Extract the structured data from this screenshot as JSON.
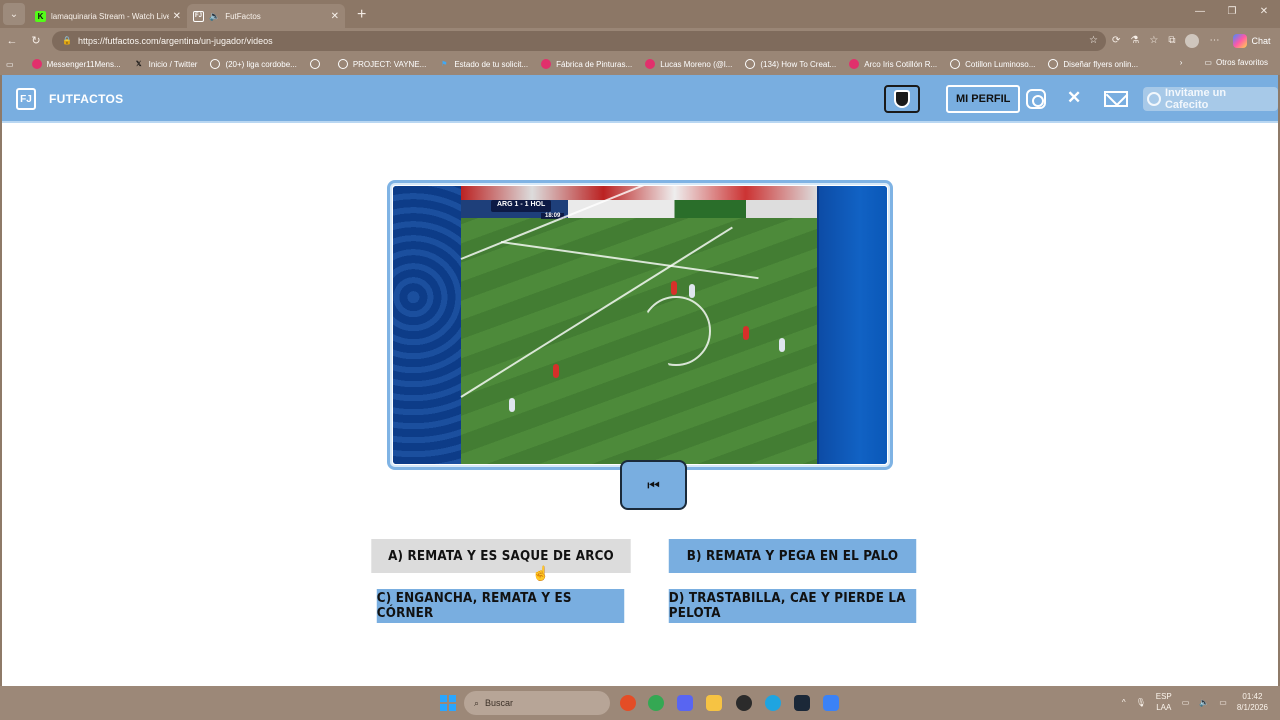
{
  "browser": {
    "tabs": [
      {
        "title": "lamaquinaria Stream - Watch Live",
        "favicon": "K"
      },
      {
        "title": "FutFactos",
        "favicon": "FJ"
      }
    ],
    "url": "https://futfactos.com/argentina/un-jugador/videos",
    "chat_label": "Chat",
    "bookmarks": [
      "Messenger11Mens...",
      "Inicio / Twitter",
      "(20+) liga cordobe...",
      "",
      "PROJECT: VAYNE...",
      "Estado de tu solicit...",
      "Fábrica de Pinturas...",
      "Lucas Moreno (@l...",
      "(134) How To Creat...",
      "Arco Iris Cotillón R...",
      "Cotillon Luminoso...",
      "Diseñar flyers onlin..."
    ],
    "other_favorites": "Otros favoritos"
  },
  "site": {
    "brand": "FUTFACTOS",
    "logo_text": "FJ",
    "profile_label": "MI PERFIL",
    "cafecito_label": "Invitame un Cafecito"
  },
  "video": {
    "score_text": "ARG  1 - 1  HOL",
    "clock_text": "18:09"
  },
  "rewind_icon": "⏮",
  "options": [
    {
      "label": "A) REMATA Y ES SAQUE DE ARCO",
      "selected": true
    },
    {
      "label": "B) REMATA Y PEGA EN EL PALO",
      "selected": false
    },
    {
      "label": "C) ENGANCHA, REMATA Y ES CÓRNER",
      "selected": false
    },
    {
      "label": "D) TRASTABILLA, CAE Y PIERDE LA PELOTA",
      "selected": false
    }
  ],
  "taskbar": {
    "search_placeholder": "Buscar",
    "lang_line1": "ESP",
    "lang_line2": "LAA",
    "time": "01:42",
    "date": "8/1/2026"
  },
  "colors": {
    "header": "#79aee0",
    "option": "#79aee0",
    "option_selected": "#dcdcdc"
  }
}
